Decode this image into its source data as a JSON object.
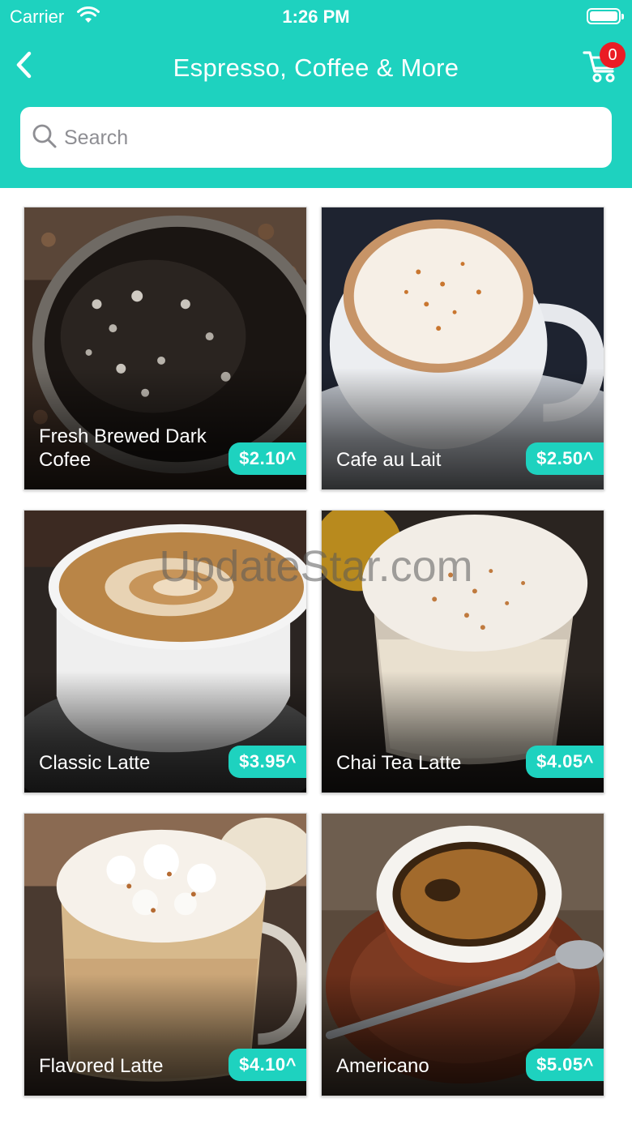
{
  "status_bar": {
    "carrier": "Carrier",
    "time": "1:26 PM"
  },
  "nav": {
    "title": "Espresso, Coffee & More",
    "cart_count": "0"
  },
  "search": {
    "placeholder": "Search"
  },
  "products": [
    {
      "name": "Fresh Brewed Dark Cofee",
      "price": "$2.10^"
    },
    {
      "name": "Cafe au Lait",
      "price": "$2.50^"
    },
    {
      "name": "Classic Latte",
      "price": "$3.95^"
    },
    {
      "name": "Chai Tea Latte",
      "price": "$4.05^"
    },
    {
      "name": "Flavored Latte",
      "price": "$4.10^"
    },
    {
      "name": "Americano",
      "price": "$5.05^"
    }
  ],
  "watermark": "UpdateStar.com",
  "colors": {
    "accent": "#1ed2bf",
    "badge": "#ea1c24"
  }
}
